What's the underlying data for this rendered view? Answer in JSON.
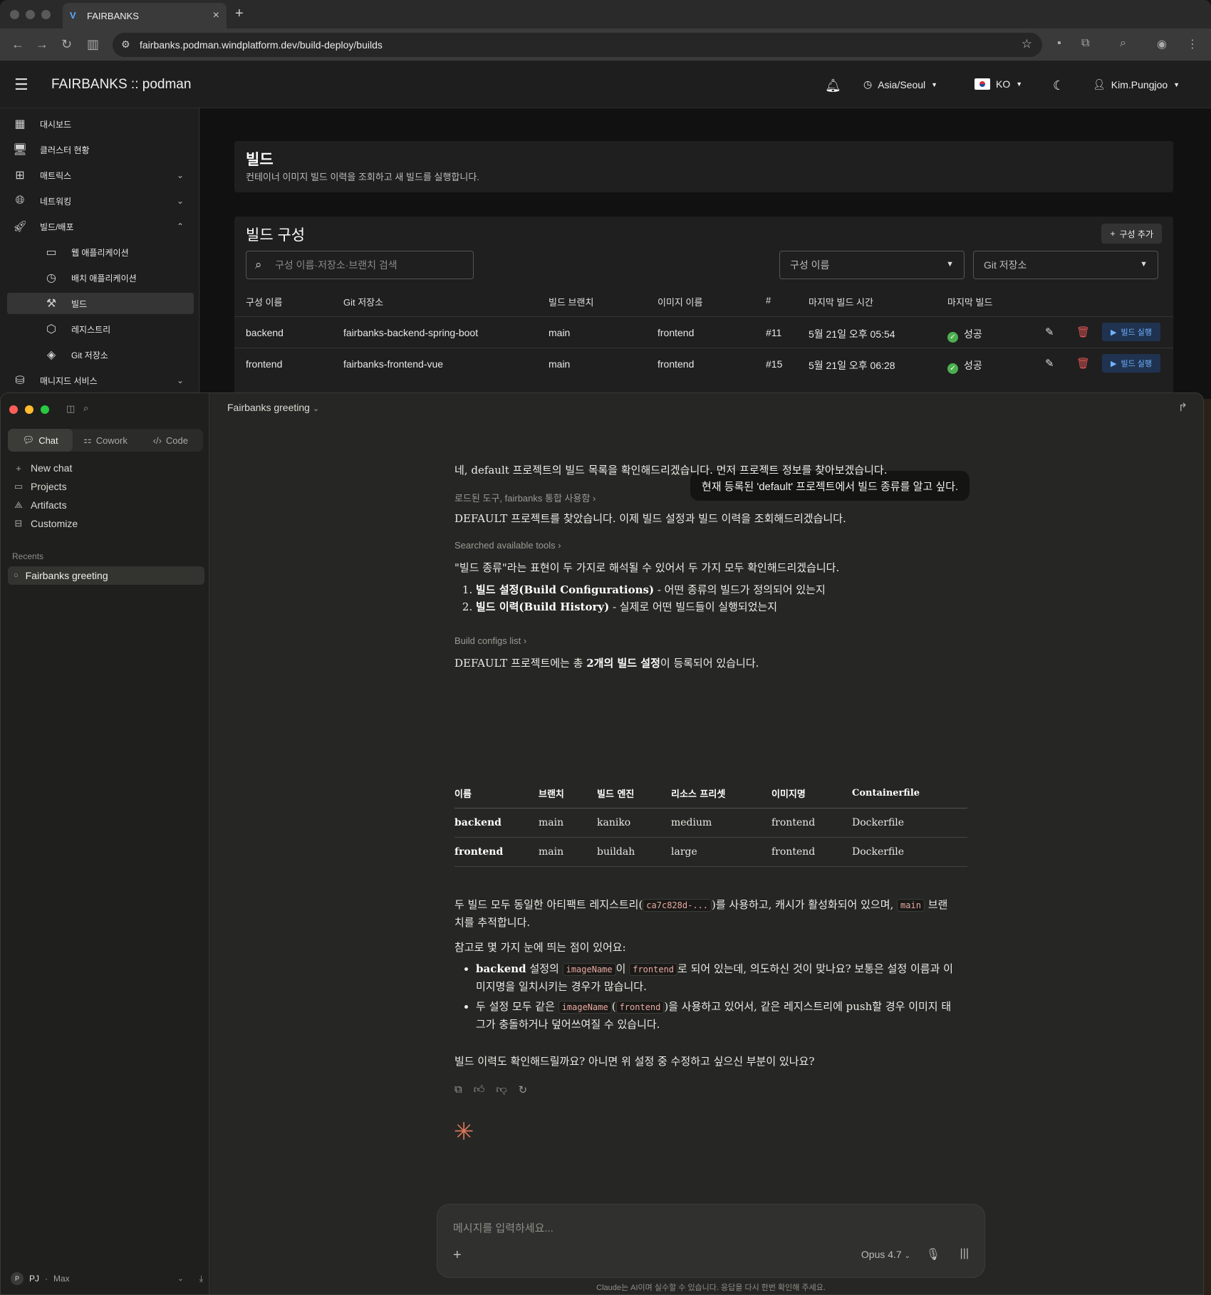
{
  "browser": {
    "tab_title": "FAIRBANKS",
    "url": "fairbanks.podman.windplatform.dev/build-deploy/builds"
  },
  "app": {
    "title": "FAIRBANKS :: podman",
    "timezone": "Asia/Seoul",
    "language": "KO",
    "user": "Kim.Pungjoo"
  },
  "nav": {
    "dashboard": "대시보드",
    "cluster": "클러스터 현황",
    "metrics": "매트릭스",
    "networking": "네트워킹",
    "build_deploy": "빌드/배포",
    "web_apps": "웹 애플리케이션",
    "batch_apps": "배치 애플리케이션",
    "builds": "빌드",
    "registry": "레지스트리",
    "git_repo": "Git 저장소",
    "managed": "매니지드 서비스"
  },
  "page": {
    "title": "빌드",
    "subtitle": "컨테이너 이미지 빌드 이력을 조회하고 새 빌드를 실행합니다."
  },
  "config_section": {
    "title": "빌드 구성",
    "add_label": "구성 추가",
    "search_placeholder": "구성 이름·저장소·브랜치 검색",
    "filter_name": "구성 이름",
    "filter_repo": "Git 저장소",
    "columns": [
      "구성 이름",
      "Git 저장소",
      "빌드 브랜치",
      "이미지 이름",
      "#",
      "마지막 빌드 시간",
      "마지막 빌드"
    ],
    "rows": [
      {
        "name": "backend",
        "repo": "fairbanks-backend-spring-boot",
        "branch": "main",
        "image": "frontend",
        "num": "#11",
        "time": "5월 21일 오후 05:54",
        "status": "성공",
        "run": "빌드 실행"
      },
      {
        "name": "frontend",
        "repo": "fairbanks-frontend-vue",
        "branch": "main",
        "image": "frontend",
        "num": "#15",
        "time": "5월 21일 오후 06:28",
        "status": "성공",
        "run": "빌드 실행"
      }
    ]
  },
  "claude": {
    "modes": [
      "Chat",
      "Cowork",
      "Code"
    ],
    "sidebar": {
      "new_chat": "New chat",
      "projects": "Projects",
      "artifacts": "Artifacts",
      "customize": "Customize",
      "recents_label": "Recents",
      "recent_item": "Fairbanks greeting",
      "user_initial": "P",
      "user_name": "PJ",
      "plan": "Max"
    },
    "conversation_title": "Fairbanks greeting",
    "user_message": "현재 등록된 'default' 프로젝트에서 빌드 종류를 알고 싶다.",
    "reply_intro": "네, default 프로젝트의 빌드 목록을 확인해드리겠습니다. 먼저 프로젝트 정보를 찾아보겠습니다.",
    "tool1": "로드된 도구, fairbanks 통합 사용함",
    "reply2": "DEFAULT 프로젝트를 찾았습니다. 이제 빌드 설정과 빌드 이력을 조회해드리겠습니다.",
    "tool2": "Searched available tools",
    "reply3": "\"빌드 종류\"라는 표현이 두 가지로 해석될 수 있어서 두 가지 모두 확인해드리겠습니다.",
    "list1_bold": "빌드 설정(Build Configurations)",
    "list1_rest": " - 어떤 종류의 빌드가 정의되어 있는지",
    "list2_bold": "빌드 이력(Build History)",
    "list2_rest": " - 실제로 어떤 빌드들이 실행되었는지",
    "tool3": "Build configs list",
    "reply4_a": "DEFAULT 프로젝트에는 총 ",
    "reply4_b": "2개의 빌드 설정",
    "reply4_c": "이 등록되어 있습니다.",
    "table": {
      "headers": [
        "이름",
        "브랜치",
        "빌드 엔진",
        "리소스 프리셋",
        "이미지명",
        "Containerfile"
      ],
      "rows": [
        [
          "backend",
          "main",
          "kaniko",
          "medium",
          "frontend",
          "Dockerfile"
        ],
        [
          "frontend",
          "main",
          "buildah",
          "large",
          "frontend",
          "Dockerfile"
        ]
      ]
    },
    "reply5_a": "두 빌드 모두 동일한 아티팩트 레지스트리(",
    "reply5_code1": "ca7c828d-...",
    "reply5_b": ")를 사용하고, 캐시가 활성화되어 있으며, ",
    "reply5_code2": "main",
    "reply5_c": " 브랜치를 추적합니다.",
    "reply6": "참고로 몇 가지 눈에 띄는 점이 있어요:",
    "bullet1_bold": "backend",
    "bullet1_a": " 설정의 ",
    "bullet1_code1": "imageName",
    "bullet1_b": "이 ",
    "bullet1_code2": "frontend",
    "bullet1_c": "로 되어 있는데, 의도하신 것이 맞나요? 보통은 설정 이름과 이미지명을 일치시키는 경우가 많습니다.",
    "bullet2_a": "두 설정 모두 같은 ",
    "bullet2_code1": "imageName",
    "bullet2_b": "(",
    "bullet2_code2": "frontend",
    "bullet2_c": ")을 사용하고 있어서, 같은 레지스트리에 push할 경우 이미지 태그가 충돌하거나 덮어쓰여질 수 있습니다.",
    "reply7": "빌드 이력도 확인해드릴까요? 아니면 위 설정 중 수정하고 싶으신 부분이 있나요?",
    "composer_placeholder": "메시지를 입력하세요...",
    "model": "Opus 4.7",
    "disclaimer": "Claude는 AI이며 실수할 수 있습니다. 응답을 다시 한번 확인해 주세요."
  },
  "colors": {
    "accent_blue": "#6fb2ff",
    "success_green": "#4caf50",
    "delete_red": "#e05555",
    "claude_orange": "#d97757"
  }
}
